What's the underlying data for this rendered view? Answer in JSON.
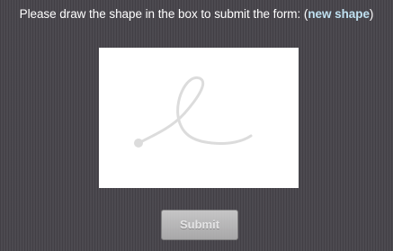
{
  "form": {
    "prompt_text": "Please draw the shape in the box to submit the form: (",
    "new_shape_link": "new shape",
    "prompt_close": ")",
    "submit_label": "Submit"
  },
  "canvas": {
    "shape_icon": "loop-stroke-icon",
    "stroke_color": "#dcdcdc"
  }
}
